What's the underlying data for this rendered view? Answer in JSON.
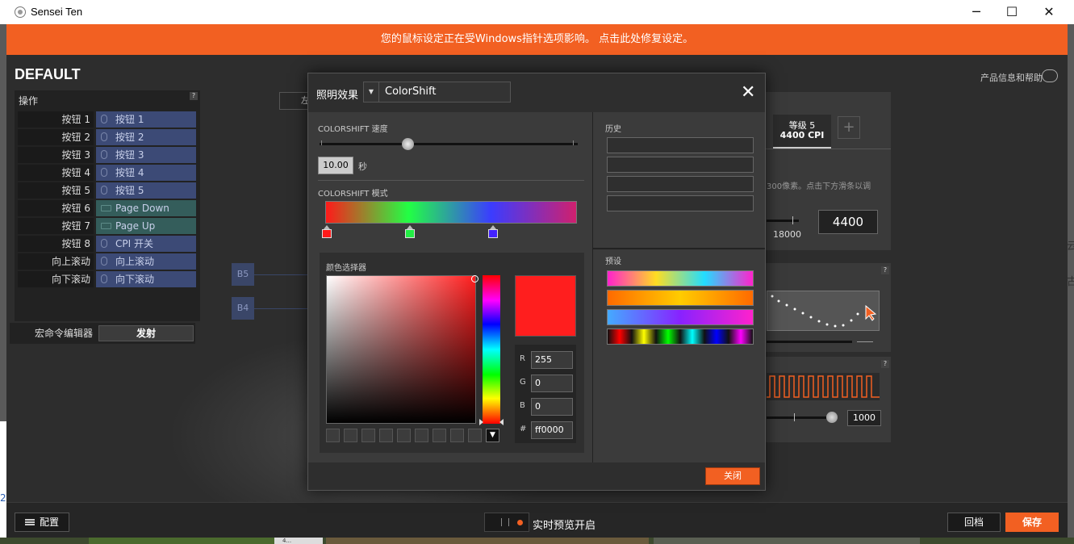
{
  "window": {
    "title": "Sensei Ten",
    "minimize": "─",
    "maximize": "☐",
    "close": "✕"
  },
  "banner": {
    "text": "您的鼠标设定正在受Windows指针选项影响。 点击此处修复设定。"
  },
  "profile": {
    "name": "DEFAULT"
  },
  "help": {
    "label": "产品信息和帮助"
  },
  "actions": {
    "title": "操作",
    "help": "?",
    "rows": [
      {
        "button": "按钮 1",
        "assign": "按钮 1",
        "type": "mouse"
      },
      {
        "button": "按钮 2",
        "assign": "按钮 2",
        "type": "mouse"
      },
      {
        "button": "按钮 3",
        "assign": "按钮 3",
        "type": "mouse"
      },
      {
        "button": "按钮 4",
        "assign": "按钮 4",
        "type": "mouse"
      },
      {
        "button": "按钮 5",
        "assign": "按钮 5",
        "type": "mouse"
      },
      {
        "button": "按钮 6",
        "assign": "Page Down",
        "type": "keyboard"
      },
      {
        "button": "按钮 7",
        "assign": "Page Up",
        "type": "keyboard"
      },
      {
        "button": "按钮 8",
        "assign": "CPI 开关",
        "type": "mouse"
      },
      {
        "button": "向上滚动",
        "assign": "向上滚动",
        "type": "mouse"
      },
      {
        "button": "向下滚动",
        "assign": "向下滚动",
        "type": "mouse"
      }
    ],
    "macro_label": "宏命令编辑器",
    "fire_label": "发射"
  },
  "button_markers": {
    "b5": "B5",
    "b4": "B4"
  },
  "partial_button": {
    "text": "左"
  },
  "cpi": {
    "tab_line1": "等级 5",
    "tab_line2": "4400 CPI",
    "add": "+",
    "desc": "300像素。点击下方滑条以调",
    "scale_max": "18000",
    "value": "4400",
    "help": "?"
  },
  "accel": {
    "help": "?"
  },
  "polling": {
    "help": "?",
    "value": "1000"
  },
  "side_glyphs": [
    "云",
    "古"
  ],
  "left_edge_glyph": "2",
  "bottom": {
    "config_label": "配置",
    "preview_label": "实时预览开启",
    "revert_label": "回档",
    "save_label": "保存"
  },
  "strip_label": "4...",
  "dialog": {
    "title": "照明效果",
    "effect": "ColorShift",
    "effect_arrow": "▼",
    "close_x": "✕",
    "speed_label": "COLORSHIFT 速度",
    "speed_value": "10.00",
    "speed_unit": "秒",
    "speed_fraction": 0.34,
    "mode_label": "COLORSHIFT 模式",
    "stops": [
      {
        "color": "#ff1a1a",
        "position": 0.0
      },
      {
        "color": "#22ee44",
        "position": 0.33
      },
      {
        "color": "#4422ff",
        "position": 0.66
      }
    ],
    "picker_label": "颜色选择器",
    "rgb": {
      "r_label": "R",
      "r": "255",
      "g_label": "G",
      "g": "0",
      "b_label": "B",
      "b": "0",
      "hex_label": "#",
      "hex": "ff0000"
    },
    "more_arrow": "▼",
    "history_label": "历史",
    "preset_label": "预设",
    "close_button": "关闭"
  }
}
